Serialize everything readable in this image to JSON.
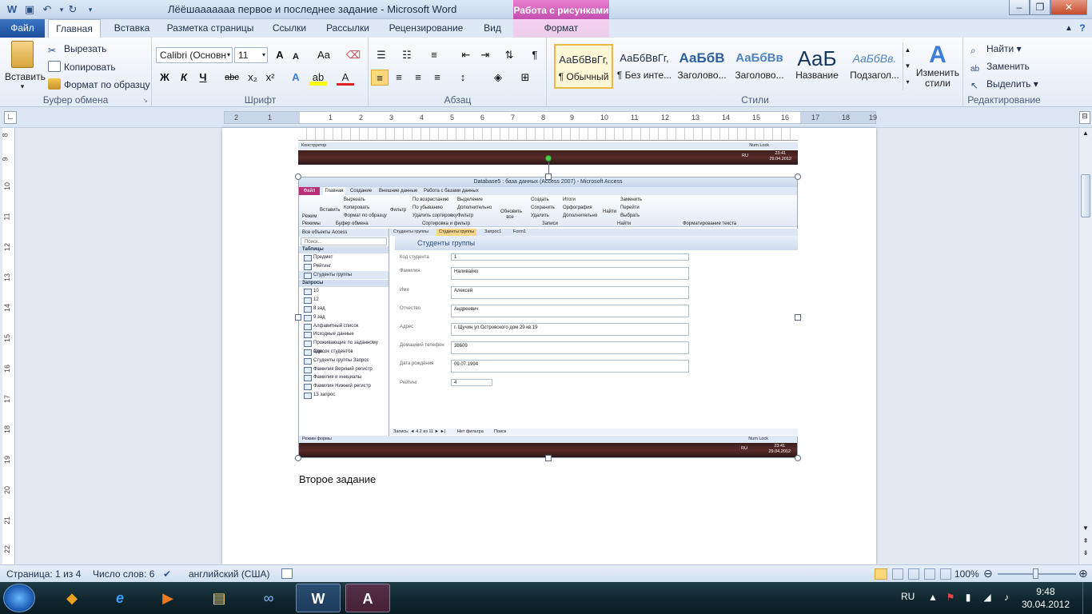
{
  "window": {
    "title": "Лёёшааааааа первое и последнее задание  -  Microsoft Word",
    "context_tab_group": "Работа с рисунками",
    "controls": {
      "minimize": "–",
      "maximize": "❐",
      "close": "✕"
    }
  },
  "tabs": [
    {
      "label": "Файл"
    },
    {
      "label": "Главная"
    },
    {
      "label": "Вставка"
    },
    {
      "label": "Разметка страницы"
    },
    {
      "label": "Ссылки"
    },
    {
      "label": "Рассылки"
    },
    {
      "label": "Рецензирование"
    },
    {
      "label": "Вид"
    },
    {
      "label": "Формат"
    }
  ],
  "ribbon": {
    "clipboard": {
      "label": "Буфер обмена",
      "paste": "Вставить",
      "cut": "Вырезать",
      "copy": "Копировать",
      "format_painter": "Формат по образцу"
    },
    "font": {
      "label": "Шрифт",
      "family": "Calibri (Основн",
      "size": "11",
      "grow": "A",
      "shrink": "A",
      "case": "Aa",
      "bold": "Ж",
      "italic": "К",
      "underline": "Ч",
      "strike": "abc",
      "sub": "x₂",
      "sup": "x²"
    },
    "paragraph": {
      "label": "Абзац"
    },
    "styles": {
      "label": "Стили",
      "items": [
        {
          "sample": "АаБбВвГг,",
          "name": "¶ Обычный"
        },
        {
          "sample": "АаБбВвГг,",
          "name": "¶ Без инте..."
        },
        {
          "sample": "АаБбВ",
          "name": "Заголово..."
        },
        {
          "sample": "АаБбВв",
          "name": "Заголово..."
        },
        {
          "sample": "АаБ",
          "name": "Название"
        },
        {
          "sample": "АаБбВв.",
          "name": "Подзагол..."
        }
      ],
      "change_styles": "Изменить стили"
    },
    "editing": {
      "label": "Редактирование",
      "find": "Найти",
      "replace": "Заменить",
      "select": "Выделить"
    }
  },
  "ruler": {
    "ticks": [
      "2",
      "1",
      "1",
      "2",
      "3",
      "4",
      "5",
      "6",
      "7",
      "8",
      "9",
      "10",
      "11",
      "12",
      "13",
      "14",
      "15",
      "16",
      "17",
      "18",
      "19"
    ],
    "vticks": [
      "8",
      "9",
      "10",
      "11",
      "12",
      "13",
      "14",
      "15",
      "16",
      "17",
      "18",
      "19",
      "20",
      "21",
      "22"
    ]
  },
  "document": {
    "body_text": "Второе задание",
    "embedded_top": {
      "status_left": "Конструктор",
      "status_right": "Num Lock",
      "tray_lang": "RU",
      "tray_time": "23:41",
      "tray_date": "29.04.2012"
    },
    "embedded_access": {
      "title": "Database5 : база данных (Access 2007) - Microsoft Access",
      "tabs": [
        "Файл",
        "Главная",
        "Создание",
        "Внешние данные",
        "Работа с базами данных"
      ],
      "ribbon_items": [
        "Режим",
        "Вставить",
        "Вырезать",
        "Копировать",
        "Формат по образцу",
        "Фильтр",
        "По возрастанию",
        "По убыванию",
        "Удалить сортировку",
        "Выделение",
        "Дополнительно",
        "Фильтр",
        "Обновить все",
        "Создать",
        "Сохранить",
        "Удалить",
        "Итоги",
        "Орфография",
        "Дополнительно",
        "Найти",
        "Заменить",
        "Перейти",
        "Выбрать"
      ],
      "ribbon_groups": [
        "Режимы",
        "Буфер обмена",
        "Сортировка и фильтр",
        "Записи",
        "Найти",
        "Форматирование текста"
      ],
      "nav_header": "Все объекты Access",
      "search_placeholder": "Поиск...",
      "tables_label": "Таблицы",
      "tables": [
        "Предмет",
        "Рейтинг",
        "Студенты группы"
      ],
      "queries_label": "Запросы",
      "queries": [
        "10",
        "12",
        "8 зад",
        "9 зад",
        "Алфавитный список",
        "Исходные данные",
        "Проживающие по заданному адр...",
        "Список студентов",
        "Студенты группы Запрос",
        "Фамилия Верхний регистр",
        "Фамилия и инициалы",
        "Фамилия Нижний регистр",
        "13 запрос"
      ],
      "doc_tabs": [
        "Студенты группы",
        "Студенты группы",
        "Запрос1",
        "Form1"
      ],
      "form_title": "Студенты группы",
      "fields": [
        {
          "label": "Код студента",
          "value": "1"
        },
        {
          "label": "Фамилия",
          "value": "Наливайко"
        },
        {
          "label": "Имя",
          "value": "Алексей"
        },
        {
          "label": "Отчество",
          "value": "Андреевич"
        },
        {
          "label": "Адрес",
          "value": "г. Щучин ул.Островского дом 29 кв.19"
        },
        {
          "label": "Домашний телефон",
          "value": "38609"
        },
        {
          "label": "Дата рождения",
          "value": "09.07.1994"
        },
        {
          "label": "Рейтинг",
          "value": "4"
        }
      ],
      "record_nav": "Запись: ◄  4  2 из 11  ► ►|",
      "no_filter": "Нет фильтра",
      "search": "Поиск",
      "status_left": "Режим формы",
      "status_right": "Num Lock",
      "tray_lang": "RU",
      "tray_time": "23:41",
      "tray_date": "29.04.2012"
    }
  },
  "statusbar": {
    "page": "Страница: 1 из 4",
    "words": "Число слов: 6",
    "language": "английский (США)",
    "zoom": "100%"
  },
  "taskbar": {
    "lang": "RU",
    "time": "9:48",
    "date": "30.04.2012"
  },
  "colors": {
    "accent": "#2b579a",
    "context_tab": "#c34fb0",
    "file_tab": "#1d4e9b"
  }
}
